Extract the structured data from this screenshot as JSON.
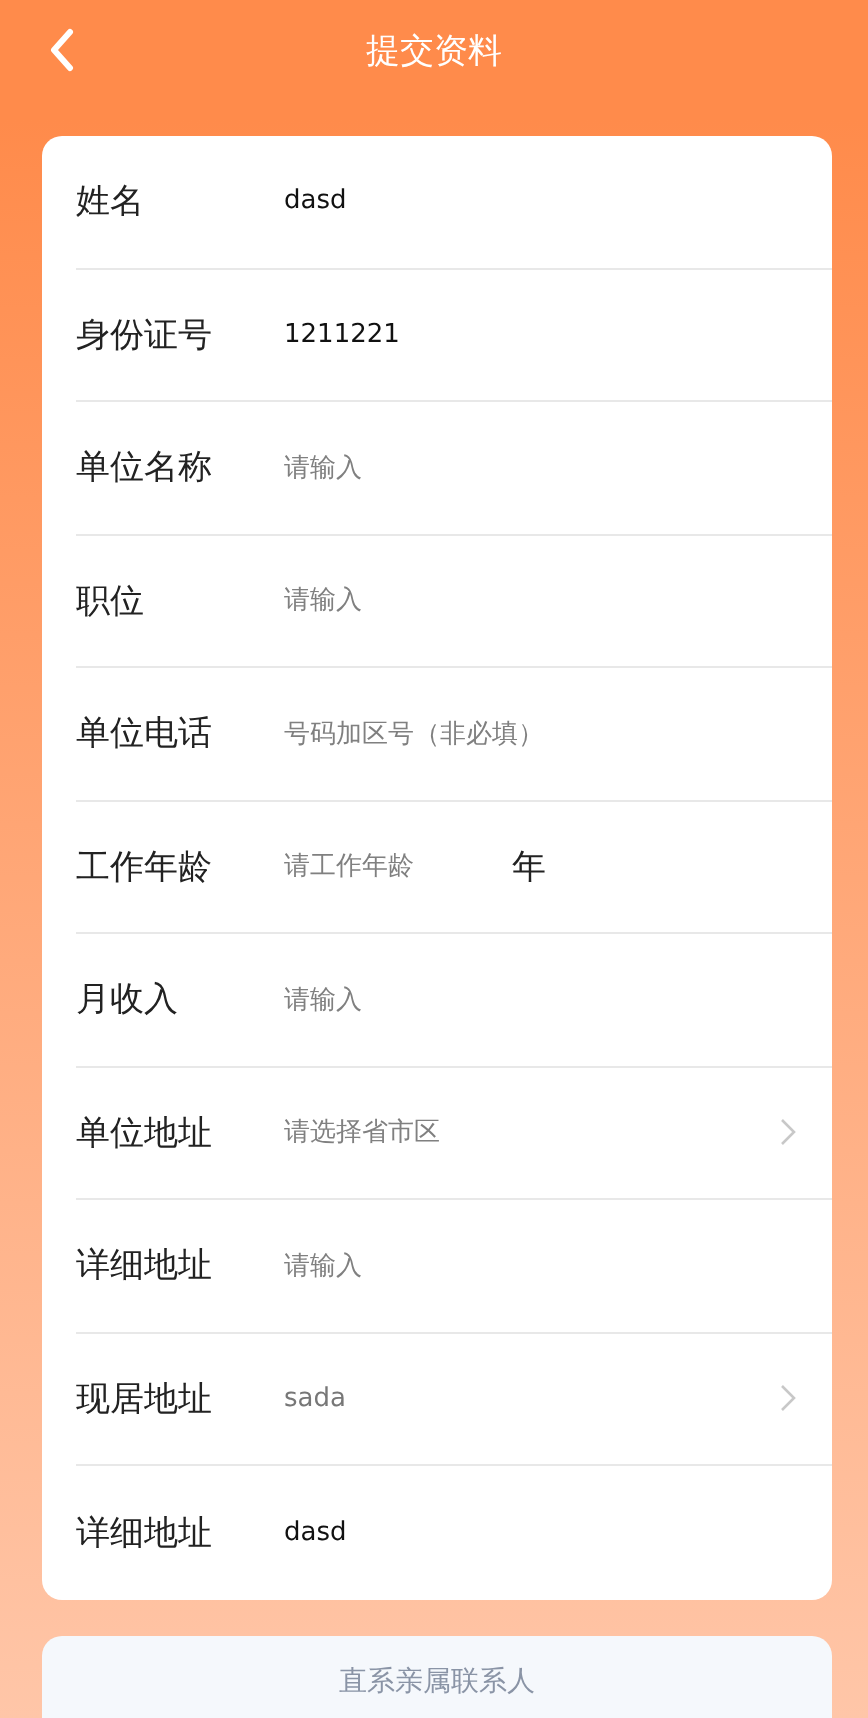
{
  "header": {
    "title": "提交资料"
  },
  "fields": [
    {
      "kind": "input",
      "label": "姓名",
      "value": "dasd"
    },
    {
      "kind": "input",
      "label": "身份证号",
      "value": "1211221"
    },
    {
      "kind": "input",
      "label": "单位名称",
      "placeholder": "请输入"
    },
    {
      "kind": "input",
      "label": "职位",
      "placeholder": "请输入"
    },
    {
      "kind": "input",
      "label": "单位电话",
      "placeholder": "号码加区号（非必填）"
    },
    {
      "kind": "input",
      "label": "工作年龄",
      "placeholder": "请工作年龄",
      "suffix": "年"
    },
    {
      "kind": "input",
      "label": "月收入",
      "placeholder": "请输入"
    },
    {
      "kind": "select",
      "label": "单位地址",
      "placeholder": "请选择省市区"
    },
    {
      "kind": "input",
      "label": "详细地址",
      "placeholder": "请输入"
    },
    {
      "kind": "select",
      "label": "现居地址",
      "value": "sada"
    },
    {
      "kind": "input",
      "label": "详细地址",
      "value": "dasd"
    }
  ],
  "section": {
    "title": "直系亲属联系人"
  }
}
